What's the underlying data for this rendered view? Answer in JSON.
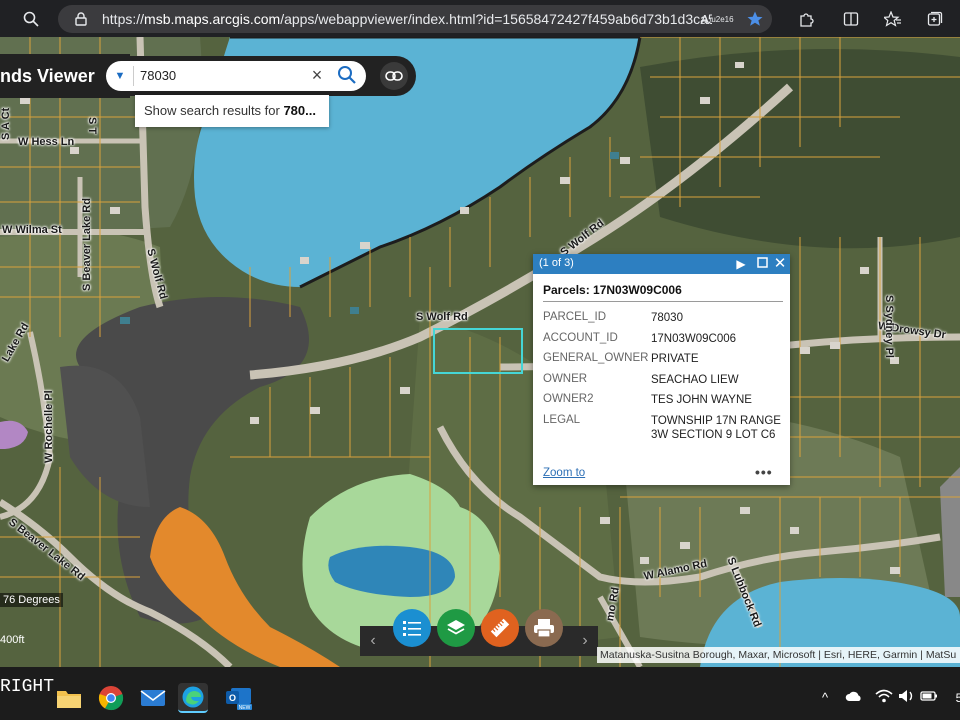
{
  "browser": {
    "url_prefix": "https://",
    "url_host": "msb.maps.arcgis.com",
    "url_path": "/apps/webappviewer/index.html?id=15658472427f459ab6d73b1d3ca5..."
  },
  "app": {
    "title": "nds Viewer"
  },
  "search": {
    "value": "78030",
    "suggestion_prefix": "Show search results for ",
    "suggestion_bold": "780..."
  },
  "roads": {
    "w_hess": "W Hess Ln",
    "w_wilma": "W Wilma St",
    "s_beaver_lake": "S Beaver Lake Rd",
    "s_beaver_lake_lower": "S Beaver Lake Rd",
    "s_wolf_vertical": "S Wolf Rd",
    "s_wolf_main": "S Wolf Rd",
    "s_wolf_upper": "S Wolf Rd",
    "w_drowsy": "W Drowsy Dr",
    "s_sydney": "S Sydney Pl",
    "w_rochelle": "W Rochelle Pl",
    "w_alamo": "W Alamo Rd",
    "s_lubbock": "S Lubbock Rd",
    "s_a_ct": "S A Ct",
    "s_t": "S T",
    "lake_rd": "Lake Rd",
    "mo_rd": "mo Rd"
  },
  "popup": {
    "count": "(1 of 3)",
    "title": "Parcels: 17N03W09C006",
    "attributes": [
      {
        "key": "PARCEL_ID",
        "value": "78030"
      },
      {
        "key": "ACCOUNT_ID",
        "value": "17N03W09C006"
      },
      {
        "key": "GENERAL_OWNER",
        "value": "PRIVATE"
      },
      {
        "key": "OWNER",
        "value": "SEACHAO LIEW"
      },
      {
        "key": "OWNER2",
        "value": "TES JOHN WAYNE"
      },
      {
        "key": "LEGAL",
        "value": "TOWNSHIP 17N RANGE 3W SECTION 9 LOT C6"
      }
    ],
    "zoom_label": "Zoom to",
    "more_label": "•••"
  },
  "map": {
    "scale_degrees": "76 Degrees",
    "scale_distance": "400ft",
    "attribution": "Matanuska-Susitna Borough, Maxar, Microsoft | Esri, HERE, Garmin | MatSu"
  },
  "taskbar": {
    "left_text": "RIGHT",
    "time_fragment": "5"
  },
  "colors": {
    "water": "#5bb3d4",
    "parcel_line": "#d9a23c",
    "highlight": "#45d6d6",
    "popup_header": "#2d7fc1",
    "wetland_orange": "#e3892c",
    "wetland_green": "#a8d89a",
    "toolbar_blue": "#1b8fd1",
    "toolbar_green": "#1f9a44",
    "toolbar_orange": "#e0621f",
    "toolbar_brown": "#8a6a50"
  },
  "icons": [
    "search-icon",
    "lock-icon",
    "star-icon",
    "extensions-icon",
    "split-icon",
    "favorites-icon",
    "collections-icon",
    "reader-icon",
    "link-icon",
    "list-icon",
    "layers-icon",
    "measure-icon",
    "print-icon"
  ]
}
